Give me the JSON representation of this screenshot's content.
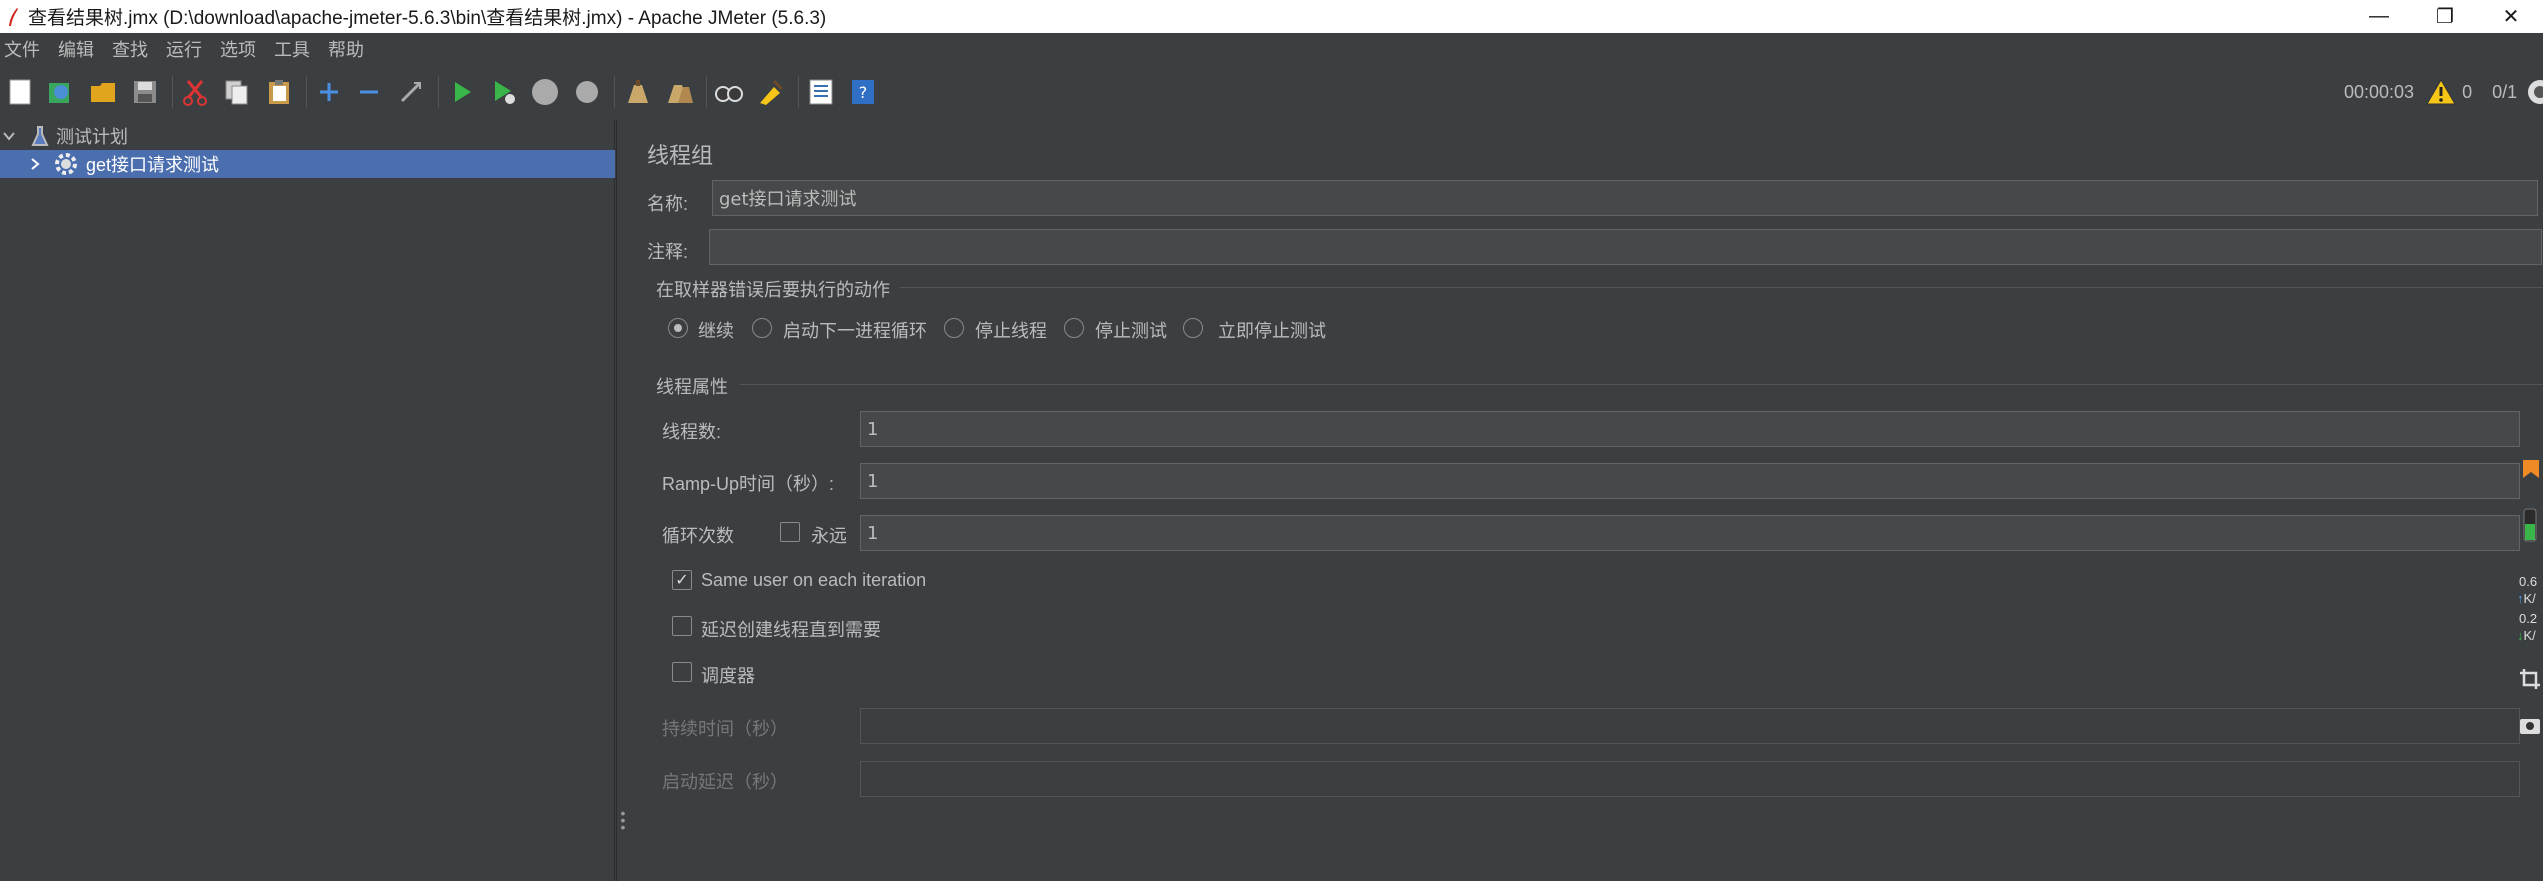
{
  "window": {
    "title": "查看结果树.jmx (D:\\download\\apache-jmeter-5.6.3\\bin\\查看结果树.jmx) - Apache JMeter (5.6.3)",
    "minimize_glyph": "—",
    "maximize_glyph": "❐",
    "close_glyph": "✕"
  },
  "menu": {
    "items": [
      "文件",
      "编辑",
      "查找",
      "运行",
      "选项",
      "工具",
      "帮助"
    ]
  },
  "toolbar": {
    "icons": [
      "new-icon",
      "templates-icon",
      "open-icon",
      "save-icon",
      "cut-icon",
      "copy-icon",
      "paste-icon",
      "expand-icon",
      "collapse-icon",
      "toggle-icon",
      "start-icon",
      "start-no-timers-icon",
      "stop-icon",
      "shutdown-icon",
      "clear-icon",
      "clear-all-icon",
      "search-icon",
      "reset-search-icon",
      "function-helper-icon",
      "help-icon"
    ],
    "elapsed_time": "00:00:03",
    "warning_count": "0",
    "threads": "0/1"
  },
  "tree": {
    "root_label": "测试计划",
    "child_label": "get接口请求测试"
  },
  "thread_group": {
    "title": "线程组",
    "name_label": "名称:",
    "name_value": "get接口请求测试",
    "comment_label": "注释:",
    "comment_value": "",
    "error_section_title": "在取样器错误后要执行的动作",
    "error_actions": [
      "继续",
      "启动下一进程循环",
      "停止线程",
      "停止测试",
      "立即停止测试"
    ],
    "selected_action": 0,
    "thread_props_title": "线程属性",
    "threads_label": "线程数:",
    "threads_value": "1",
    "rampup_label": "Ramp-Up时间（秒）:",
    "rampup_value": "1",
    "loop_label": "循环次数",
    "forever_label": "永远",
    "forever_checked": false,
    "loop_value": "1",
    "same_user_label": "Same user on each iteration",
    "same_user_checked": true,
    "delay_label": "延迟创建线程直到需要",
    "delay_checked": false,
    "scheduler_label": "调度器",
    "scheduler_checked": false,
    "duration_label": "持续时间（秒）",
    "duration_value": "",
    "startup_delay_label": "启动延迟（秒）",
    "startup_delay_value": ""
  },
  "side_monitor": {
    "up_value": "0.6",
    "up_unit": "K/",
    "down_value": "0.2",
    "down_unit": "K/"
  },
  "colors": {
    "background": "#3c3f41",
    "selection": "#4b6eaf",
    "field_bg": "#45494a",
    "text": "#bbbbbb"
  }
}
